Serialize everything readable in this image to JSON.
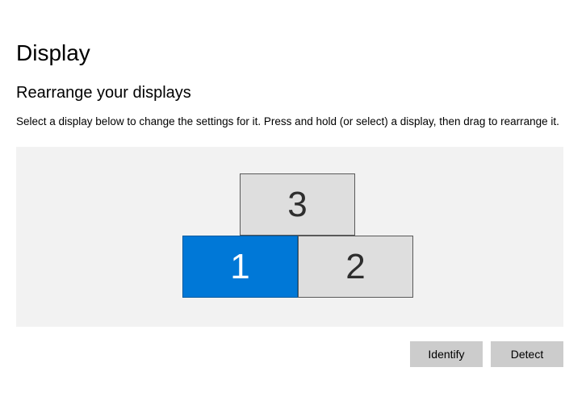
{
  "page_title": "Display",
  "section_heading": "Rearrange your displays",
  "description": "Select a display below to change the settings for it. Press and hold (or select) a display, then drag to rearrange it.",
  "monitors": {
    "m1": "1",
    "m2": "2",
    "m3": "3"
  },
  "buttons": {
    "identify": "Identify",
    "detect": "Detect"
  }
}
